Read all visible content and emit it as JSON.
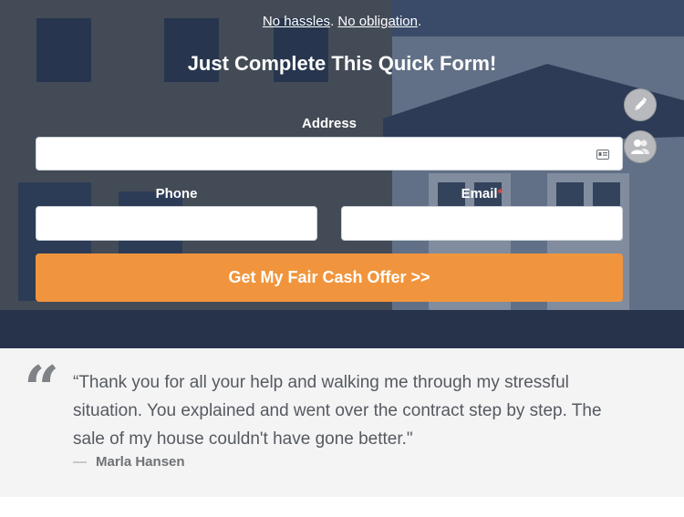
{
  "hero": {
    "tagline_link1": "No hassles",
    "tagline_sep": ". ",
    "tagline_link2": "No obligation",
    "tagline_end": ".",
    "title": "Just Complete This Quick Form!"
  },
  "form": {
    "address_label": "Address",
    "address_value": "",
    "phone_label": "Phone",
    "phone_value": "",
    "email_label": "Email",
    "email_required_mark": "*",
    "email_value": "",
    "submit_label": "Get My Fair Cash Offer >>"
  },
  "side_tools": {
    "edit_icon": "pencil-icon",
    "users_icon": "users-icon"
  },
  "testimonial": {
    "quote_mark": "“",
    "text": "“Thank you for all your help and walking me through my stressful situation. You explained and went over the contract step by step. The sale of my house couldn't have gone better.\"",
    "dash": "—",
    "author": "Marla Hansen"
  },
  "colors": {
    "accent": "#f0953d",
    "hero_overlay": "#23375a",
    "testimonial_bg": "#f4f4f5"
  }
}
